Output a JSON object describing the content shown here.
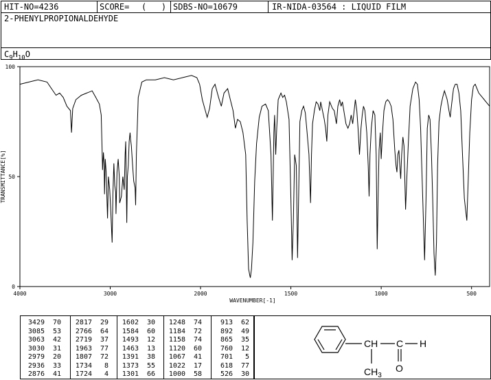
{
  "header": {
    "hit_no": "HIT-NO=4236",
    "score": "SCORE=",
    "score_value": "(   )",
    "sdbs_no": "SDBS-NO=10679",
    "ir_code": "IR-NIDA-03564 : LIQUID FILM"
  },
  "compound_name": "2-PHENYLPROPIONALDEHYDE",
  "formula": {
    "c": "C",
    "c_sub": "9",
    "h": "H",
    "h_sub": "10",
    "o": "O"
  },
  "chart_data": {
    "type": "line",
    "xlabel": "WAVENUMBER[-1]",
    "ylabel": "TRANSMITTANCE[%]",
    "xlim": [
      4000,
      400
    ],
    "ylim": [
      0,
      100
    ],
    "x_ticks": [
      "4000",
      "3000",
      "2000",
      "1500",
      "1000",
      "500"
    ],
    "y_ticks": [
      "100",
      "50",
      "0"
    ],
    "grid": false,
    "x_scale": "piecewise: 4000-2000 compressed, 2000-400 expanded",
    "series": [
      {
        "points": [
          [
            4000,
            92
          ],
          [
            3900,
            93
          ],
          [
            3800,
            94
          ],
          [
            3700,
            93
          ],
          [
            3650,
            90
          ],
          [
            3600,
            87
          ],
          [
            3560,
            88
          ],
          [
            3520,
            86
          ],
          [
            3480,
            82
          ],
          [
            3440,
            80
          ],
          [
            3429,
            70
          ],
          [
            3415,
            81
          ],
          [
            3380,
            85
          ],
          [
            3320,
            87
          ],
          [
            3260,
            88
          ],
          [
            3200,
            89
          ],
          [
            3160,
            86
          ],
          [
            3120,
            83
          ],
          [
            3100,
            78
          ],
          [
            3090,
            62
          ],
          [
            3085,
            53
          ],
          [
            3075,
            61
          ],
          [
            3068,
            56
          ],
          [
            3063,
            42
          ],
          [
            3055,
            58
          ],
          [
            3045,
            52
          ],
          [
            3030,
            31
          ],
          [
            3020,
            50
          ],
          [
            3005,
            44
          ],
          [
            2995,
            35
          ],
          [
            2979,
            20
          ],
          [
            2970,
            42
          ],
          [
            2960,
            56
          ],
          [
            2950,
            46
          ],
          [
            2940,
            43
          ],
          [
            2936,
            33
          ],
          [
            2925,
            52
          ],
          [
            2912,
            58
          ],
          [
            2900,
            50
          ],
          [
            2895,
            38
          ],
          [
            2876,
            41
          ],
          [
            2860,
            50
          ],
          [
            2845,
            44
          ],
          [
            2835,
            60
          ],
          [
            2828,
            66
          ],
          [
            2817,
            29
          ],
          [
            2810,
            50
          ],
          [
            2800,
            55
          ],
          [
            2790,
            66
          ],
          [
            2780,
            70
          ],
          [
            2775,
            67
          ],
          [
            2766,
            64
          ],
          [
            2755,
            57
          ],
          [
            2740,
            48
          ],
          [
            2725,
            45
          ],
          [
            2719,
            37
          ],
          [
            2710,
            60
          ],
          [
            2690,
            86
          ],
          [
            2650,
            93
          ],
          [
            2600,
            94
          ],
          [
            2500,
            94
          ],
          [
            2400,
            95
          ],
          [
            2300,
            94
          ],
          [
            2200,
            95
          ],
          [
            2100,
            96
          ],
          [
            2040,
            95
          ],
          [
            2010,
            92
          ],
          [
            1990,
            85
          ],
          [
            1970,
            79
          ],
          [
            1963,
            77
          ],
          [
            1950,
            81
          ],
          [
            1935,
            90
          ],
          [
            1920,
            92
          ],
          [
            1900,
            86
          ],
          [
            1885,
            82
          ],
          [
            1870,
            88
          ],
          [
            1850,
            90
          ],
          [
            1835,
            85
          ],
          [
            1820,
            80
          ],
          [
            1807,
            72
          ],
          [
            1795,
            76
          ],
          [
            1780,
            75
          ],
          [
            1765,
            70
          ],
          [
            1750,
            60
          ],
          [
            1742,
            30
          ],
          [
            1734,
            8
          ],
          [
            1727,
            5
          ],
          [
            1724,
            4
          ],
          [
            1718,
            8
          ],
          [
            1710,
            20
          ],
          [
            1700,
            48
          ],
          [
            1690,
            65
          ],
          [
            1675,
            77
          ],
          [
            1660,
            82
          ],
          [
            1640,
            83
          ],
          [
            1625,
            80
          ],
          [
            1610,
            60
          ],
          [
            1602,
            30
          ],
          [
            1598,
            50
          ],
          [
            1594,
            70
          ],
          [
            1590,
            78
          ],
          [
            1584,
            60
          ],
          [
            1578,
            72
          ],
          [
            1570,
            85
          ],
          [
            1555,
            88
          ],
          [
            1545,
            86
          ],
          [
            1535,
            87
          ],
          [
            1525,
            84
          ],
          [
            1510,
            76
          ],
          [
            1500,
            40
          ],
          [
            1493,
            12
          ],
          [
            1486,
            30
          ],
          [
            1479,
            60
          ],
          [
            1470,
            55
          ],
          [
            1463,
            13
          ],
          [
            1456,
            45
          ],
          [
            1450,
            75
          ],
          [
            1440,
            80
          ],
          [
            1430,
            82
          ],
          [
            1420,
            79
          ],
          [
            1410,
            70
          ],
          [
            1400,
            60
          ],
          [
            1391,
            38
          ],
          [
            1386,
            60
          ],
          [
            1380,
            74
          ],
          [
            1370,
            80
          ],
          [
            1360,
            84
          ],
          [
            1350,
            83
          ],
          [
            1340,
            80
          ],
          [
            1335,
            84
          ],
          [
            1325,
            80
          ],
          [
            1315,
            76
          ],
          [
            1308,
            72
          ],
          [
            1301,
            66
          ],
          [
            1295,
            78
          ],
          [
            1285,
            84
          ],
          [
            1270,
            81
          ],
          [
            1260,
            80
          ],
          [
            1248,
            74
          ],
          [
            1240,
            82
          ],
          [
            1230,
            85
          ],
          [
            1222,
            82
          ],
          [
            1215,
            84
          ],
          [
            1205,
            79
          ],
          [
            1195,
            74
          ],
          [
            1184,
            72
          ],
          [
            1175,
            74
          ],
          [
            1166,
            78
          ],
          [
            1158,
            74
          ],
          [
            1150,
            80
          ],
          [
            1143,
            85
          ],
          [
            1135,
            80
          ],
          [
            1128,
            72
          ],
          [
            1120,
            60
          ],
          [
            1112,
            72
          ],
          [
            1105,
            78
          ],
          [
            1098,
            82
          ],
          [
            1090,
            80
          ],
          [
            1080,
            70
          ],
          [
            1072,
            55
          ],
          [
            1067,
            41
          ],
          [
            1062,
            60
          ],
          [
            1055,
            72
          ],
          [
            1045,
            80
          ],
          [
            1035,
            78
          ],
          [
            1028,
            60
          ],
          [
            1022,
            17
          ],
          [
            1017,
            42
          ],
          [
            1012,
            62
          ],
          [
            1005,
            70
          ],
          [
            1000,
            58
          ],
          [
            993,
            70
          ],
          [
            985,
            80
          ],
          [
            975,
            84
          ],
          [
            965,
            85
          ],
          [
            955,
            84
          ],
          [
            945,
            82
          ],
          [
            935,
            76
          ],
          [
            925,
            62
          ],
          [
            918,
            55
          ],
          [
            913,
            52
          ],
          [
            908,
            60
          ],
          [
            902,
            62
          ],
          [
            897,
            55
          ],
          [
            892,
            49
          ],
          [
            887,
            60
          ],
          [
            880,
            68
          ],
          [
            874,
            64
          ],
          [
            865,
            35
          ],
          [
            858,
            50
          ],
          [
            850,
            65
          ],
          [
            840,
            82
          ],
          [
            825,
            90
          ],
          [
            810,
            93
          ],
          [
            800,
            92
          ],
          [
            790,
            85
          ],
          [
            782,
            72
          ],
          [
            770,
            40
          ],
          [
            760,
            12
          ],
          [
            752,
            40
          ],
          [
            745,
            72
          ],
          [
            737,
            78
          ],
          [
            730,
            76
          ],
          [
            722,
            60
          ],
          [
            715,
            40
          ],
          [
            708,
            15
          ],
          [
            701,
            5
          ],
          [
            694,
            20
          ],
          [
            688,
            55
          ],
          [
            680,
            75
          ],
          [
            670,
            82
          ],
          [
            660,
            86
          ],
          [
            650,
            89
          ],
          [
            635,
            85
          ],
          [
            625,
            80
          ],
          [
            618,
            77
          ],
          [
            610,
            83
          ],
          [
            600,
            90
          ],
          [
            590,
            92
          ],
          [
            580,
            92
          ],
          [
            570,
            88
          ],
          [
            560,
            80
          ],
          [
            550,
            60
          ],
          [
            540,
            40
          ],
          [
            526,
            30
          ],
          [
            518,
            50
          ],
          [
            510,
            70
          ],
          [
            500,
            85
          ],
          [
            490,
            91
          ],
          [
            480,
            92
          ],
          [
            470,
            90
          ],
          [
            460,
            88
          ],
          [
            450,
            87
          ],
          [
            440,
            86
          ],
          [
            430,
            85
          ],
          [
            420,
            84
          ],
          [
            410,
            83
          ],
          [
            400,
            82
          ]
        ]
      }
    ]
  },
  "peak_table": [
    [
      [
        "3429",
        "70"
      ],
      [
        "3085",
        "53"
      ],
      [
        "3063",
        "42"
      ],
      [
        "3030",
        "31"
      ],
      [
        "2979",
        "20"
      ],
      [
        "2936",
        "33"
      ],
      [
        "2876",
        "41"
      ]
    ],
    [
      [
        "2817",
        "29"
      ],
      [
        "2766",
        "64"
      ],
      [
        "2719",
        "37"
      ],
      [
        "1963",
        "77"
      ],
      [
        "1807",
        "72"
      ],
      [
        "1734",
        "8"
      ],
      [
        "1724",
        "4"
      ]
    ],
    [
      [
        "1602",
        "30"
      ],
      [
        "1584",
        "60"
      ],
      [
        "1493",
        "12"
      ],
      [
        "1463",
        "13"
      ],
      [
        "1391",
        "38"
      ],
      [
        "1373",
        "55"
      ],
      [
        "1301",
        "66"
      ]
    ],
    [
      [
        "1248",
        "74"
      ],
      [
        "1184",
        "72"
      ],
      [
        "1158",
        "74"
      ],
      [
        "1120",
        "60"
      ],
      [
        "1067",
        "41"
      ],
      [
        "1022",
        "17"
      ],
      [
        "1000",
        "58"
      ]
    ],
    [
      [
        "913",
        "62"
      ],
      [
        "892",
        "49"
      ],
      [
        "865",
        "35"
      ],
      [
        "760",
        "12"
      ],
      [
        "701",
        "5"
      ],
      [
        "618",
        "77"
      ],
      [
        "526",
        "30"
      ]
    ]
  ],
  "structure": {
    "ch": "CH",
    "c": "C",
    "h": "H",
    "o": "O",
    "methyl": "CH",
    "methyl_sub": "3"
  }
}
